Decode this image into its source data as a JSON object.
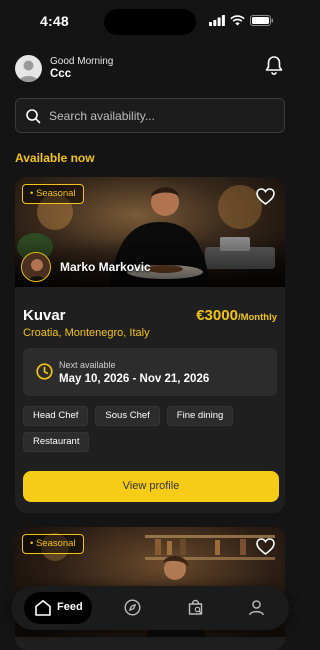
{
  "status": {
    "time": "4:48"
  },
  "header": {
    "greeting": "Good Morning",
    "user_name": "Ccc"
  },
  "search": {
    "placeholder": "Search availability..."
  },
  "section_title": "Available now",
  "listings": [
    {
      "badge": "• Seasonal",
      "chef_name": "Marko Markovic",
      "title": "Kuvar",
      "location": "Croatia, Montenegro, Italy",
      "price": "€3000",
      "price_unit": "/Monthly",
      "next_label": "Next available",
      "next_dates": "May 10, 2026 - Nov 21, 2026",
      "tags": [
        "Head Chef",
        "Sous Chef",
        "Fine dining",
        "Restaurant"
      ],
      "cta": "View profile"
    },
    {
      "badge": "• Seasonal"
    }
  ],
  "tabbar": {
    "items": [
      {
        "label": "Feed",
        "icon": "home-icon",
        "active": true
      },
      {
        "icon": "compass-icon"
      },
      {
        "icon": "bag-search-icon"
      },
      {
        "icon": "profile-icon"
      }
    ]
  },
  "colors": {
    "accent": "#f2c318",
    "button": "#f7cc16",
    "background": "#141414",
    "card": "#1f1f1f"
  }
}
